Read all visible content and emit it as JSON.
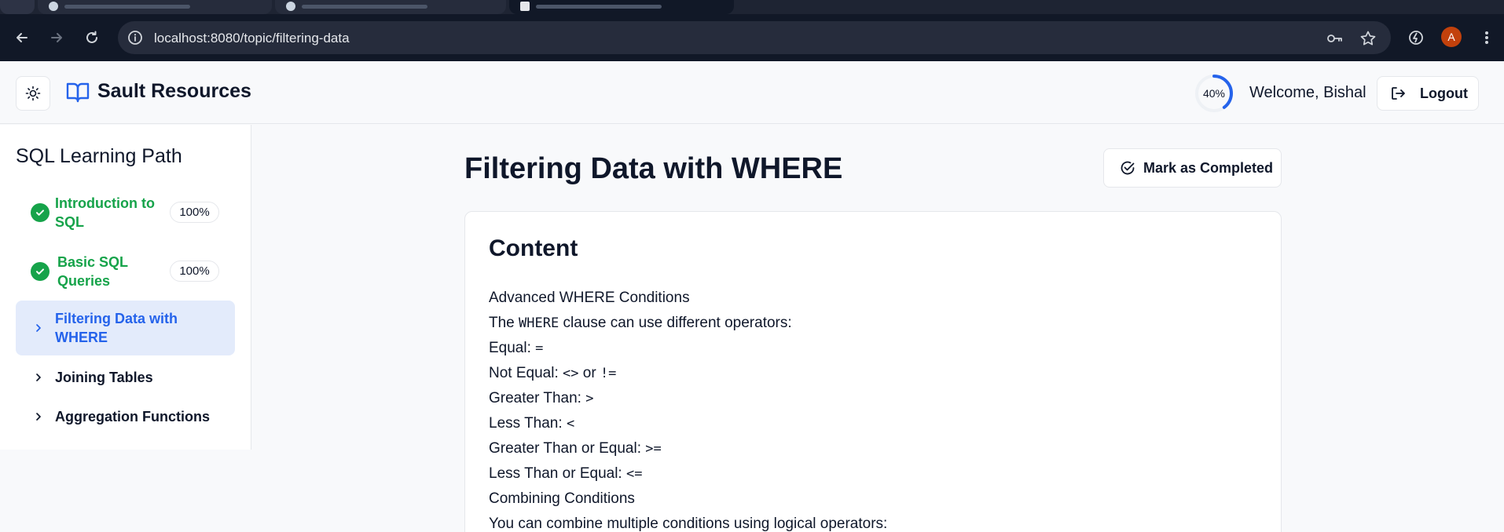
{
  "browser": {
    "url": "localhost:8080/topic/filtering-data",
    "profile_initial": "A"
  },
  "header": {
    "brand_name": "Sault Resources",
    "progress_percent": 40,
    "progress_label": "40%",
    "welcome_text": "Welcome, Bishal",
    "logout_label": "Logout"
  },
  "sidebar": {
    "title": "SQL Learning Path",
    "items": [
      {
        "label_line1": "Introduction to",
        "label_line2": "SQL",
        "badge": "100%",
        "status": "completed"
      },
      {
        "label_line1": "Basic SQL",
        "label_line2": "Queries",
        "badge": "100%",
        "status": "completed"
      },
      {
        "label_line1": "Filtering Data with",
        "label_line2": "WHERE",
        "status": "current"
      },
      {
        "label": "Joining Tables",
        "status": "locked"
      },
      {
        "label": "Aggregation Functions",
        "status": "locked"
      }
    ]
  },
  "main": {
    "title": "Filtering Data with WHERE",
    "mark_completed_label": "Mark as Completed",
    "card_title": "Content",
    "lines": {
      "l1": "Advanced WHERE Conditions",
      "l2_pre": "The ",
      "l2_code": "WHERE",
      "l2_post": " clause can use different operators:",
      "l3_text": "Equal: ",
      "l3_code": "=",
      "l4_text": "Not Equal: ",
      "l4_code1": "<>",
      "l4_mid": " or ",
      "l4_code2": "!=",
      "l5_text": "Greater Than: ",
      "l5_code": ">",
      "l6_text": "Less Than: ",
      "l6_code": "<",
      "l7_text": "Greater Than or Equal: ",
      "l7_code": ">=",
      "l8_text": "Less Than or Equal: ",
      "l8_code": "<=",
      "l9": "Combining Conditions",
      "l10": "You can combine multiple conditions using logical operators:"
    }
  },
  "colors": {
    "accent_blue": "#2563eb",
    "success_green": "#16a34a",
    "active_bg": "#e3ebfb"
  }
}
